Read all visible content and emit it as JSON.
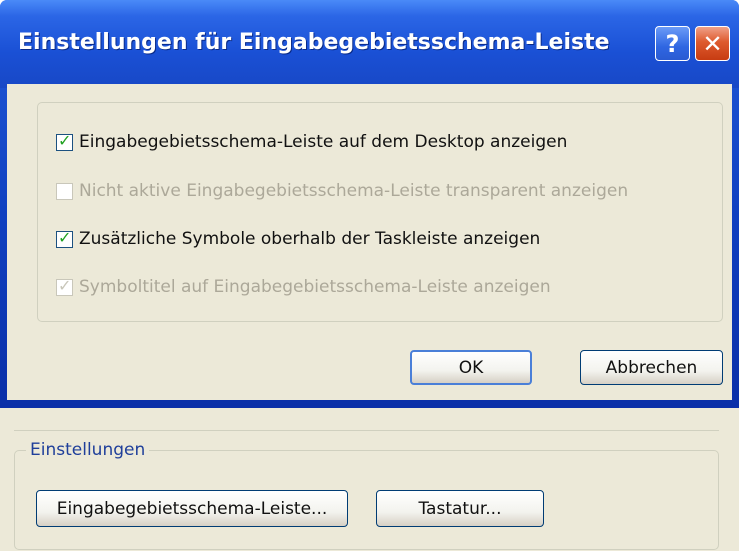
{
  "dialog": {
    "title": "Einstellungen für Eingabegebietsschema-Leiste",
    "help_label": "?",
    "close_label": "✕",
    "options": [
      {
        "label": "Eingabegebietsschema-Leiste auf dem Desktop anzeigen",
        "checked": true,
        "enabled": true
      },
      {
        "label": "Nicht aktive Eingabegebietsschema-Leiste transparent anzeigen",
        "checked": false,
        "enabled": false
      },
      {
        "label": "Zusätzliche Symbole oberhalb der Taskleiste anzeigen",
        "checked": true,
        "enabled": true
      },
      {
        "label": "Symboltitel auf Eingabegebietsschema-Leiste anzeigen",
        "checked": true,
        "enabled": false
      }
    ],
    "ok_label": "OK",
    "cancel_label": "Abbrechen"
  },
  "background": {
    "group_label": "Einstellungen",
    "language_bar_button": "Eingabegebietsschema-Leiste...",
    "keyboard_button": "Tastatur..."
  },
  "colors": {
    "title_bar": "#1a50d5",
    "dialog_face": "#ece9d8",
    "checkmark": "#21a121",
    "disabled_text": "#aca899"
  }
}
